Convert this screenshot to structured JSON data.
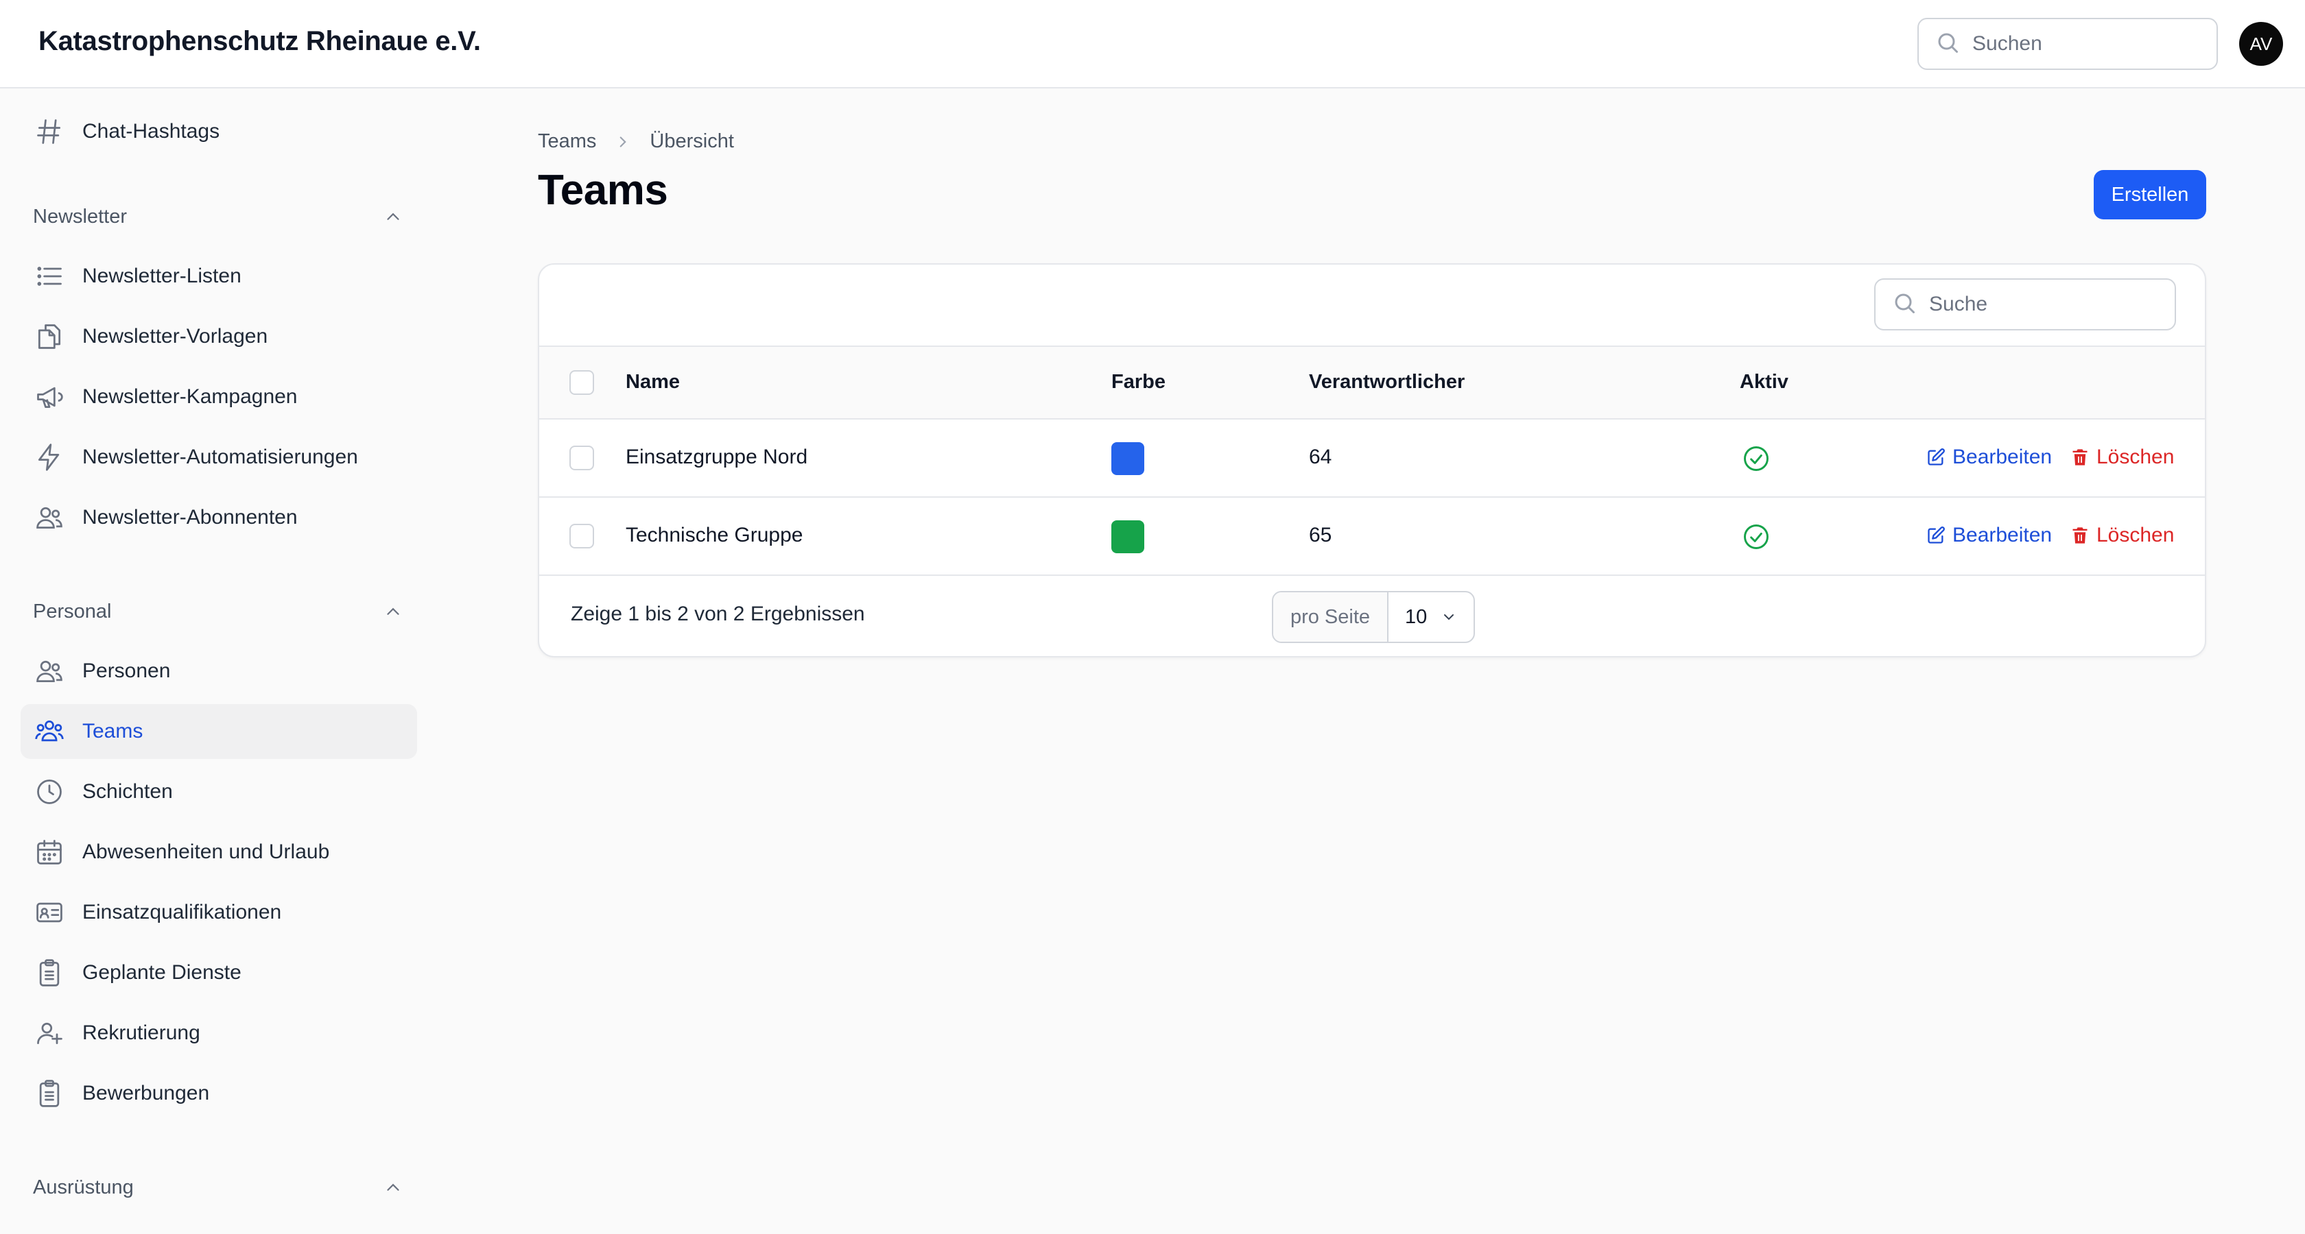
{
  "app": {
    "title": "Katastrophenschutz Rheinaue e.V."
  },
  "topbar": {
    "search_placeholder": "Suchen",
    "avatar_initials": "AV"
  },
  "sidebar": {
    "top_item": {
      "label": "Chat-Hashtags",
      "icon": "hashtag-icon"
    },
    "groups": [
      {
        "label": "Newsletter",
        "items": [
          {
            "label": "Newsletter-Listen",
            "icon": "list-icon"
          },
          {
            "label": "Newsletter-Vorlagen",
            "icon": "documents-icon"
          },
          {
            "label": "Newsletter-Kampagnen",
            "icon": "megaphone-icon"
          },
          {
            "label": "Newsletter-Automatisierungen",
            "icon": "bolt-icon"
          },
          {
            "label": "Newsletter-Abonnenten",
            "icon": "users-icon"
          }
        ]
      },
      {
        "label": "Personal",
        "items": [
          {
            "label": "Personen",
            "icon": "users-icon"
          },
          {
            "label": "Teams",
            "icon": "user-group-icon",
            "active": true
          },
          {
            "label": "Schichten",
            "icon": "clock-icon"
          },
          {
            "label": "Abwesenheiten und Urlaub",
            "icon": "calendar-icon"
          },
          {
            "label": "Einsatzqualifikationen",
            "icon": "id-card-icon"
          },
          {
            "label": "Geplante Dienste",
            "icon": "clipboard-icon"
          },
          {
            "label": "Rekrutierung",
            "icon": "user-plus-icon"
          },
          {
            "label": "Bewerbungen",
            "icon": "clipboard-icon"
          }
        ]
      },
      {
        "label": "Ausrüstung",
        "items": []
      }
    ]
  },
  "main": {
    "breadcrumb": [
      "Teams",
      "Übersicht"
    ],
    "title": "Teams",
    "create_label": "Erstellen",
    "table": {
      "search_placeholder": "Suche",
      "columns": [
        "Name",
        "Farbe",
        "Verantwortlicher",
        "Aktiv"
      ],
      "rows": [
        {
          "name": "Einsatzgruppe Nord",
          "color": "#2563eb",
          "responsible": "64",
          "active": true
        },
        {
          "name": "Technische Gruppe",
          "color": "#16a34a",
          "responsible": "65",
          "active": true
        }
      ],
      "edit_label": "Bearbeiten",
      "delete_label": "Löschen",
      "summary": "Zeige 1 bis 2 von 2 Ergebnissen",
      "per_page_label": "pro Seite",
      "per_page_value": "10"
    }
  },
  "colors": {
    "accent": "#1d5cf5",
    "link": "#1d4ed8",
    "danger": "#dc2626",
    "success": "#16a34a"
  }
}
